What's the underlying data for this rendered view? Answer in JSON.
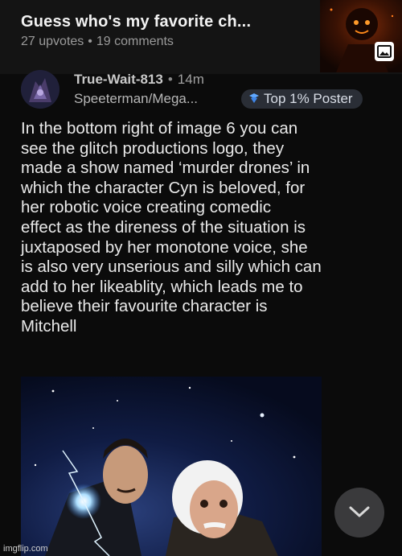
{
  "post": {
    "title": "Guess who's my favorite ch...",
    "upvotes": "27 upvotes",
    "separator": "•",
    "comments": "19 comments",
    "thumbnail_icon": "image-icon"
  },
  "comment": {
    "username": "True-Wait-813",
    "separator": "•",
    "time": "14m",
    "user_flair": "Speeterman/Mega...",
    "badge": "Top 1% Poster",
    "body": "In the bottom right of image 6 you can\nsee the glitch productions logo, they\nmade a show named ‘murder drones’ in\nwhich the character Cyn is beloved, for\nher robotic voice creating comedic\neffect as the direness of the situation is\njuxtaposed by her monotone voice, she\nis also very unserious and silly which can\nadd to her likeablity, which leads me to\nbelieve their favourite character is\nMitchell"
  },
  "controls": {
    "scroll_down_icon": "chevron-down-icon"
  },
  "watermark": "imgflip.com",
  "colors": {
    "background": "#0b0b0b",
    "header": "#141414",
    "badge_bg": "#2a2e36",
    "badge_icon": "#5fa8ff",
    "scroll_button": "#3a3a3c"
  }
}
